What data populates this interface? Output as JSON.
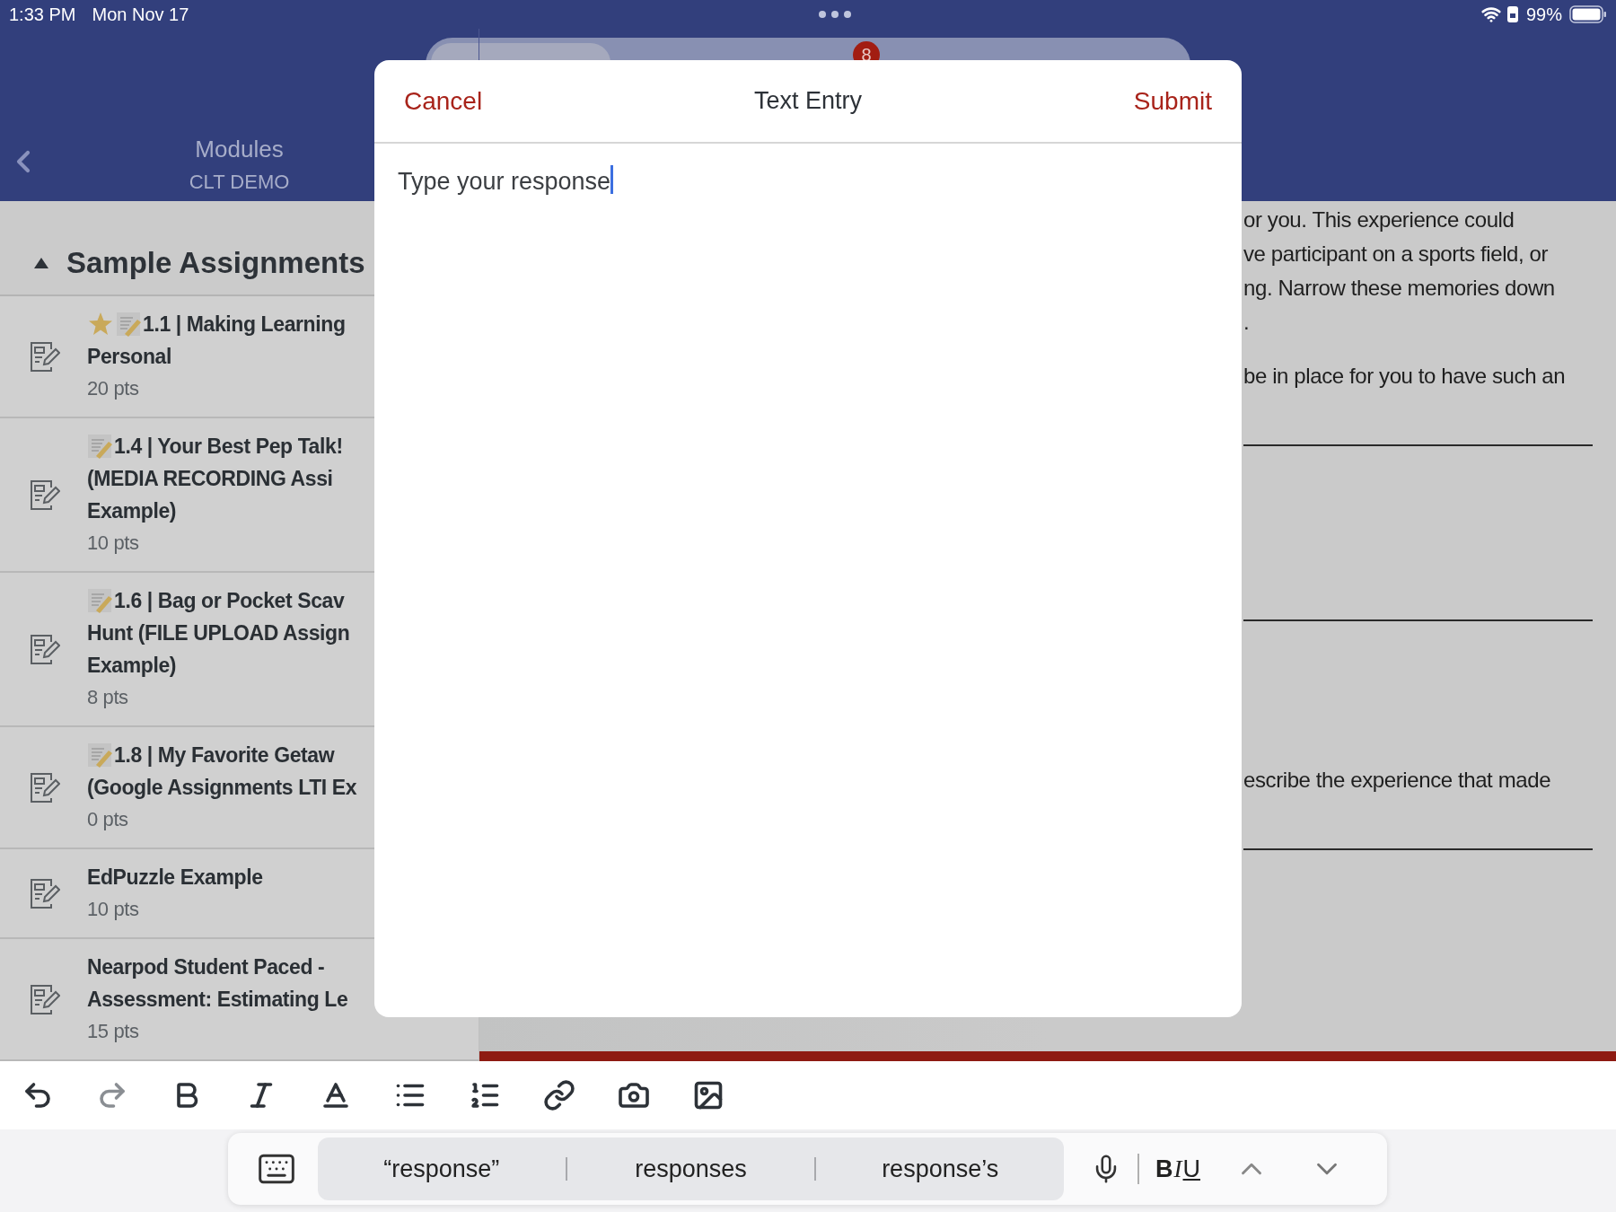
{
  "status_bar": {
    "time": "1:33 PM",
    "date": "Mon Nov 17",
    "battery": "99%"
  },
  "nav": {
    "title": "Modules",
    "subtitle": "CLT DEMO",
    "notification_count": "8"
  },
  "module": {
    "title": "Sample Assignments",
    "expanded": true,
    "items": [
      {
        "starred": true,
        "memo": true,
        "lines": [
          "1.1 | Making Learning",
          "Personal"
        ],
        "points": "20 pts"
      },
      {
        "starred": false,
        "memo": true,
        "lines": [
          "1.4 | Your Best Pep Talk!",
          "(MEDIA RECORDING Assi",
          "Example)"
        ],
        "points": "10 pts"
      },
      {
        "starred": false,
        "memo": true,
        "lines": [
          "1.6 | Bag or Pocket Scav",
          "Hunt (FILE UPLOAD Assign",
          "Example)"
        ],
        "points": "8 pts"
      },
      {
        "starred": false,
        "memo": true,
        "lines": [
          "1.8 | My Favorite Getaw",
          "(Google Assignments LTI Ex"
        ],
        "points": "0 pts"
      },
      {
        "starred": false,
        "memo": false,
        "lines": [
          "EdPuzzle Example"
        ],
        "points": "10 pts"
      },
      {
        "starred": false,
        "memo": false,
        "lines": [
          "Nearpod Student Paced -",
          "Assessment: Estimating Le"
        ],
        "points": "15 pts"
      }
    ]
  },
  "content": [
    {
      "kind": "paragraph",
      "lines": [
        "or you. This experience could",
        "ve participant on a sports field, or",
        "ng. Narrow these memories down",
        "."
      ]
    },
    {
      "kind": "paragraph",
      "lines": [
        "be in place for you to have such an"
      ]
    },
    {
      "kind": "answer_line"
    },
    {
      "kind": "answer_line"
    },
    {
      "kind": "paragraph",
      "lines": [
        "escribe the experience that made"
      ]
    },
    {
      "kind": "answer_line"
    }
  ],
  "progress_bar": {
    "level": 1
  },
  "dialog": {
    "cancel": "Cancel",
    "title": "Text Entry",
    "submit": "Submit",
    "placeholder": "Type your response",
    "focused": true
  },
  "toolbar": [
    {
      "kind": "undo",
      "disabled": false
    },
    {
      "kind": "redo",
      "disabled": true
    },
    {
      "kind": "bold",
      "disabled": false
    },
    {
      "kind": "italic",
      "disabled": false
    },
    {
      "kind": "text_color",
      "disabled": false
    },
    {
      "kind": "bullets",
      "disabled": false
    },
    {
      "kind": "numbers",
      "disabled": false
    },
    {
      "kind": "link",
      "disabled": false
    },
    {
      "kind": "camera",
      "disabled": false
    },
    {
      "kind": "image",
      "disabled": false
    }
  ],
  "suggestions": [
    "“response”",
    "responses",
    "response’s"
  ],
  "format_letters": {
    "bold": "B",
    "italic": "I",
    "underline": "U"
  }
}
